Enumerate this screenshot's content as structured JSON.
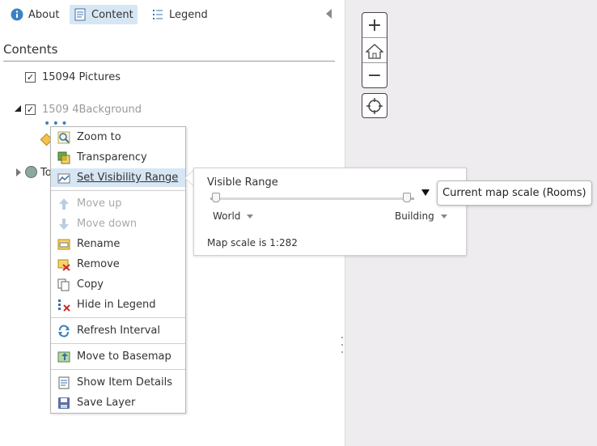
{
  "tabs": [
    {
      "label": "About",
      "icon": "info-icon"
    },
    {
      "label": "Content",
      "icon": "content-icon",
      "active": true
    },
    {
      "label": "Legend",
      "icon": "legend-icon"
    }
  ],
  "contents_title": "Contents",
  "layers": [
    {
      "label": "15094 Pictures",
      "checked": true
    },
    {
      "label": "1509 4Background",
      "checked": true
    },
    {
      "label": "To"
    }
  ],
  "menu": {
    "zoom_to": "Zoom to",
    "transparency": "Transparency",
    "set_visibility_range": "Set Visibility Range",
    "move_up": "Move up",
    "move_down": "Move down",
    "rename": "Rename",
    "remove": "Remove",
    "copy": "Copy",
    "hide_in_legend": "Hide in Legend",
    "refresh_interval": "Refresh Interval",
    "move_to_basemap": "Move to Basemap",
    "show_item_details": "Show Item Details",
    "save_layer": "Save Layer"
  },
  "visibility": {
    "title": "Visible Range",
    "min_label": "World",
    "max_label": "Building",
    "scale_text": "Map scale is 1:282",
    "tooltip": "Current map scale (Rooms)"
  },
  "map_controls": {
    "zoom_in": "+",
    "zoom_out": "−"
  },
  "colors": {
    "active_tab_bg": "#d7e6f3",
    "link_blue": "#3b7fc4",
    "map_bg": "#efecef"
  }
}
